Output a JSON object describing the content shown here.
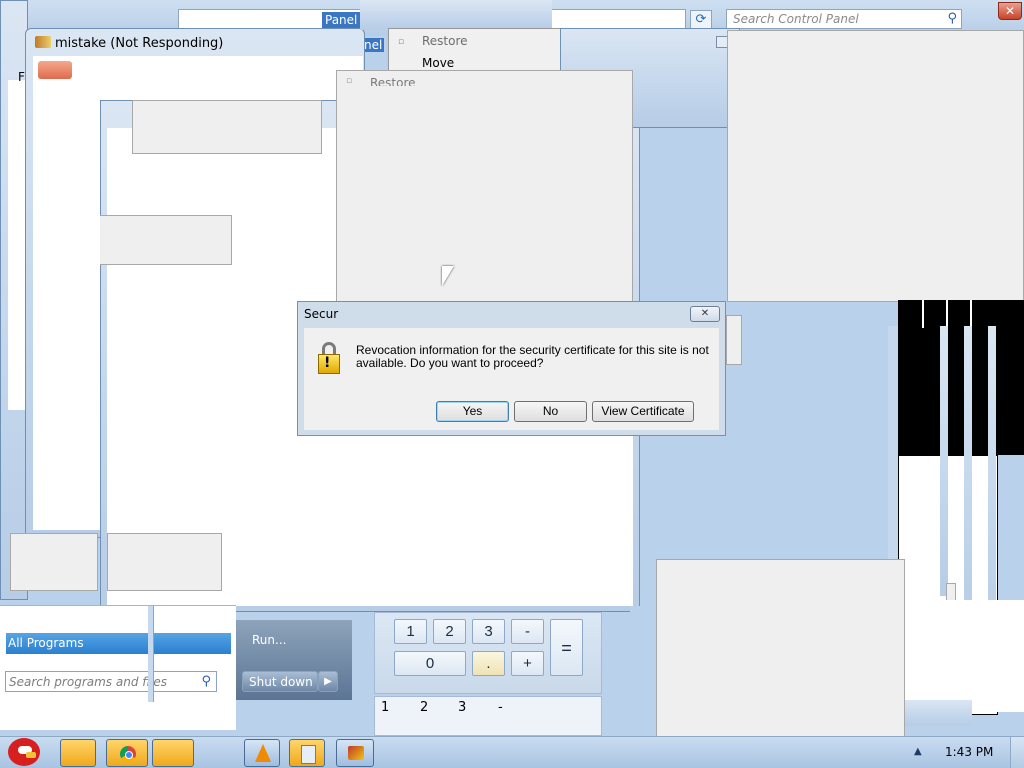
{
  "control_panel": {
    "address_crumb": "Panel",
    "address_crumb_2": "nel",
    "search_placeholder": "Search Control Panel"
  },
  "window_mistake": {
    "title": "mistake (Not Responding)",
    "menu_letter": "F"
  },
  "system_menu_1": {
    "items": [
      "Restore",
      "Move"
    ]
  },
  "system_menu_2": {
    "items": [
      "Restore"
    ]
  },
  "dialog": {
    "title": "Secur",
    "message_line1": "Revocation information for the security certificate for this site is not",
    "message_line2": "available. Do you want to proceed?",
    "yes": "Yes",
    "no": "No",
    "view_certificate": "View Certificate"
  },
  "start_menu": {
    "all_programs": "All Programs",
    "search_placeholder": "Search programs and files",
    "run": "Run...",
    "shut_down": "Shut down"
  },
  "calculator": {
    "row1": [
      "1",
      "2",
      "3",
      "-"
    ],
    "row2": [
      "0",
      ".",
      "+"
    ],
    "equals": "=",
    "ghost_row": [
      "1",
      "2",
      "3",
      "-"
    ]
  },
  "taskbar": {
    "clock": "1:43 PM",
    "icons": [
      "angry-birds-icon",
      "folder-icon",
      "chrome-icon",
      "folder-icon",
      "vlc-icon",
      "calculator-icon",
      "paint-icon"
    ]
  }
}
